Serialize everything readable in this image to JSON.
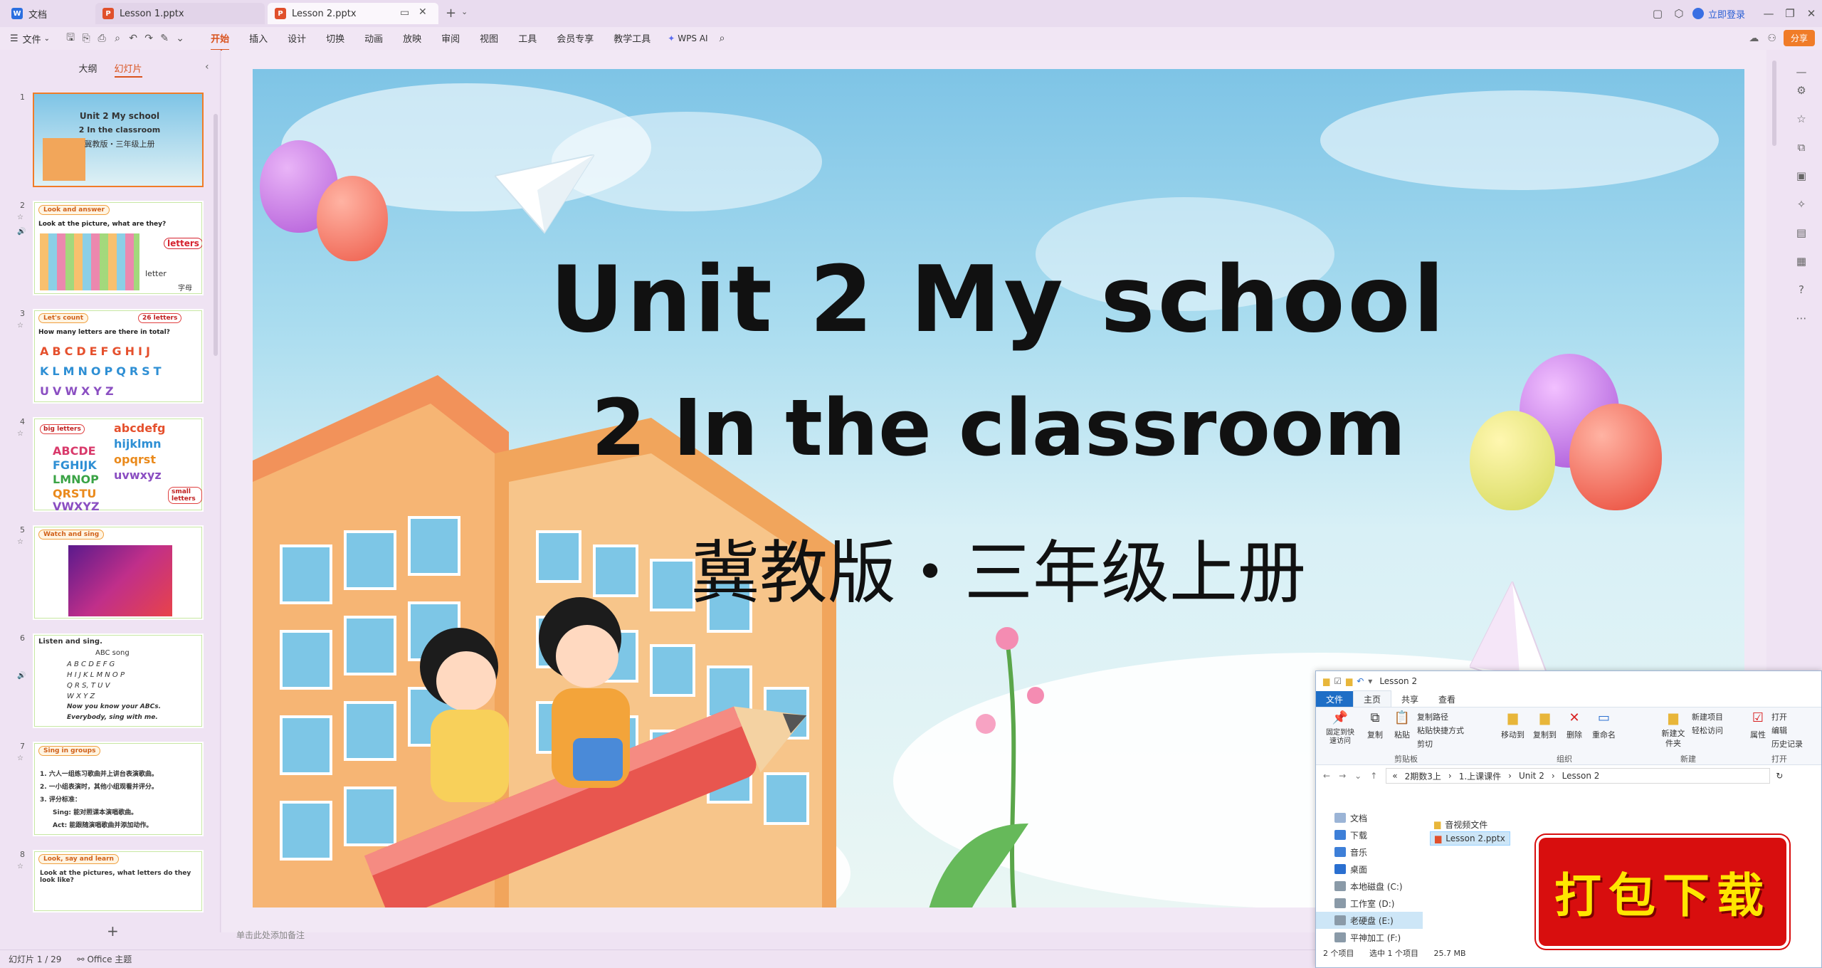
{
  "titlebar": {
    "tabs": [
      {
        "label": "文档",
        "icon": "docs-icon"
      },
      {
        "label": "Lesson 1.pptx",
        "icon": "ppt-icon"
      },
      {
        "label": "Lesson 2.pptx",
        "icon": "ppt-icon"
      }
    ],
    "login_label": "立即登录"
  },
  "menubar": {
    "file_label": "文件",
    "tabs": [
      "开始",
      "插入",
      "设计",
      "切换",
      "动画",
      "放映",
      "审阅",
      "视图",
      "工具",
      "会员专享",
      "教学工具"
    ],
    "active_tab": "开始",
    "wps_ai_label": "WPS AI",
    "share_label": "分享"
  },
  "leftpanel": {
    "tabs": [
      "大纲",
      "幻灯片"
    ],
    "active_tab": "幻灯片",
    "slides": [
      {
        "num": "1",
        "label": "",
        "lines": [
          "Unit 2 My school",
          "2 In the classroom",
          "冀教版・三年级上册"
        ]
      },
      {
        "num": "2",
        "label": "Look and answer",
        "lines": [
          "Look at the picture, what are they?",
          "letters",
          "letter",
          "字母"
        ]
      },
      {
        "num": "3",
        "label": "Let's count",
        "lines": [
          "26 letters",
          "How many letters are there in total?",
          "ABCDEFGHIJ",
          "KLMNOPQRST",
          "UVWXYZ"
        ]
      },
      {
        "num": "4",
        "label": "",
        "lines": [
          "big letters",
          "abcdefg",
          "hijklmn",
          "opqrst",
          "uvwxyz",
          "ABCDE",
          "FGHIJK",
          "LMNOP",
          "QRSTU",
          "VWXYZ",
          "small letters"
        ]
      },
      {
        "num": "5",
        "label": "Watch and sing",
        "lines": []
      },
      {
        "num": "6",
        "label": "",
        "lines": [
          "Listen and sing.",
          "ABC song",
          "A B C D E F G",
          "H I J K L M N O P",
          "Q R S, T U V",
          "W X Y Z",
          "Now you know your ABCs.",
          "Everybody, sing with me."
        ]
      },
      {
        "num": "7",
        "label": "Sing in groups",
        "lines": [
          "1. 六人一组练习歌曲并上讲台表演歌曲。",
          "2. 一小组表演时，其他小组观看并评分。",
          "3. 评分标准：",
          "Sing: 能对照课本演唱歌曲。",
          "Act: 能跟随演唱歌曲并添加动作。"
        ]
      },
      {
        "num": "8",
        "label": "Look, say and learn",
        "lines": [
          "Look at the pictures, what letters do they look like?"
        ]
      }
    ]
  },
  "slide": {
    "title": "Unit 2 My school",
    "subtitle": "2 In the classroom",
    "edition": "冀教版・三年级上册"
  },
  "notes_placeholder": "单击此处添加备注",
  "statusbar": {
    "slide_info": "幻灯片 1 / 29",
    "theme": "Office 主题"
  },
  "explorer": {
    "title": "Lesson 2",
    "tabs": [
      "文件",
      "主页",
      "共享",
      "查看"
    ],
    "ribbon": {
      "clipboard": {
        "pin": "固定到快速访问",
        "copy": "复制",
        "paste": "粘贴",
        "copy_path": "复制路径",
        "paste_shortcut": "粘贴快捷方式",
        "cut": "剪切",
        "group": "剪贴板"
      },
      "organize": {
        "move_to": "移动到",
        "copy_to": "复制到",
        "delete": "删除",
        "rename": "重命名",
        "group": "组织"
      },
      "new": {
        "new_folder": "新建文件夹",
        "new_item": "新建项目",
        "easy_access": "轻松访问",
        "group": "新建"
      },
      "open": {
        "properties": "属性",
        "open": "打开",
        "edit": "编辑",
        "history": "历史记录",
        "group": "打开"
      }
    },
    "breadcrumb": [
      "«",
      "2期数3上",
      "1.上课课件",
      "Unit 2",
      "Lesson 2"
    ],
    "tree": [
      "文档",
      "下载",
      "音乐",
      "桌面",
      "本地磁盘 (C:)",
      "工作室 (D:)",
      "老硬盘 (E:)",
      "平神加工 (F:)"
    ],
    "files": [
      "音视频文件",
      "Lesson 2.pptx"
    ],
    "status": {
      "count": "2 个项目",
      "selected": "选中 1 个项目",
      "size": "25.7 MB"
    }
  },
  "stamp_text": "打包下载"
}
